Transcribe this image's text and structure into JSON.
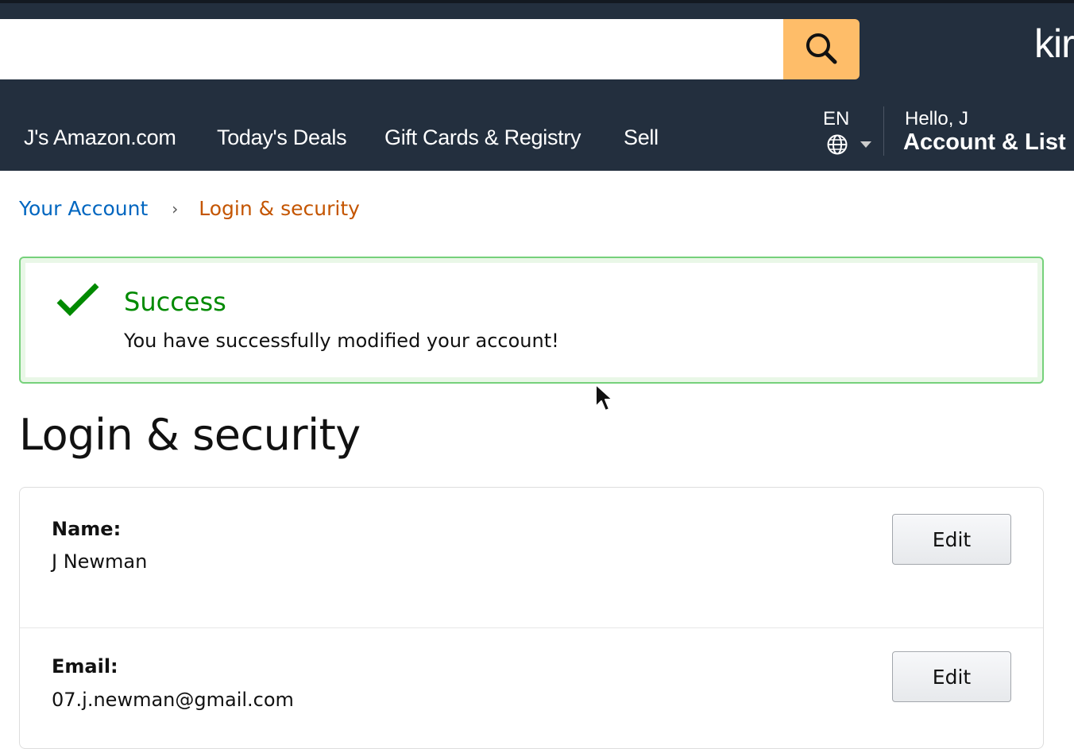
{
  "header": {
    "search": {
      "value": "",
      "placeholder": ""
    },
    "search_button_icon": "search-icon",
    "brand_text": "kir",
    "nav_links": [
      {
        "label": "J's Amazon.com"
      },
      {
        "label": "Today's Deals"
      },
      {
        "label": "Gift Cards & Registry"
      },
      {
        "label": "Sell"
      }
    ],
    "language": {
      "code": "EN",
      "icon": "globe-icon",
      "dropdown_icon": "caret-down-icon"
    },
    "account": {
      "greeting": "Hello, J",
      "label": "Account & List"
    },
    "colors": {
      "background": "#232f3e",
      "search_button": "#febd69"
    }
  },
  "breadcrumb": {
    "parent": "Your Account",
    "separator": "›",
    "current": "Login & security",
    "colors": {
      "link": "#0066c0",
      "current": "#c45500"
    }
  },
  "alert": {
    "icon": "checkmark-icon",
    "heading": "Success",
    "message": "You have successfully modified your account!",
    "colors": {
      "heading": "#008a00",
      "border": "#76d17b"
    }
  },
  "page": {
    "title": "Login & security"
  },
  "settings": {
    "rows": [
      {
        "label": "Name:",
        "value": "J Newman",
        "action": "Edit"
      },
      {
        "label": "Email:",
        "value": "07.j.newman@gmail.com",
        "action": "Edit"
      }
    ]
  }
}
